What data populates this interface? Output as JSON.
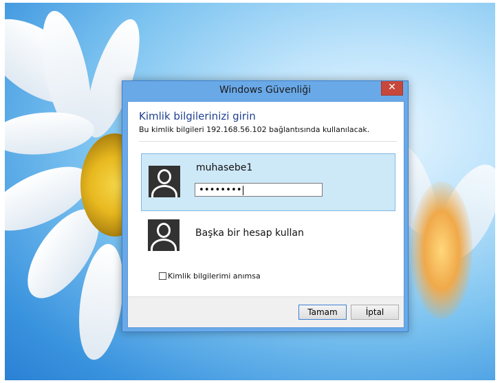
{
  "dialog": {
    "title": "Windows Güvenliği",
    "close_icon": "close-icon",
    "header_title": "Kimlik bilgilerinizi girin",
    "header_subtitle": "Bu kimlik bilgileri 192.168.56.102 bağlantısında kullanılacak.",
    "account": {
      "username": "muhasebe1",
      "password_masked": "••••••••",
      "avatar_icon": "user-avatar-icon"
    },
    "other_account": {
      "label": "Başka bir hesap kullan",
      "avatar_icon": "user-avatar-icon"
    },
    "remember": {
      "label": "Kimlik bilgilerimi anımsa",
      "checked": false
    },
    "buttons": {
      "ok": "Tamam",
      "cancel": "İptal"
    }
  },
  "colors": {
    "frame": "#6aa9e8",
    "close": "#c7483a",
    "selected_bg": "#cde8f7",
    "heading": "#1e3f90"
  }
}
